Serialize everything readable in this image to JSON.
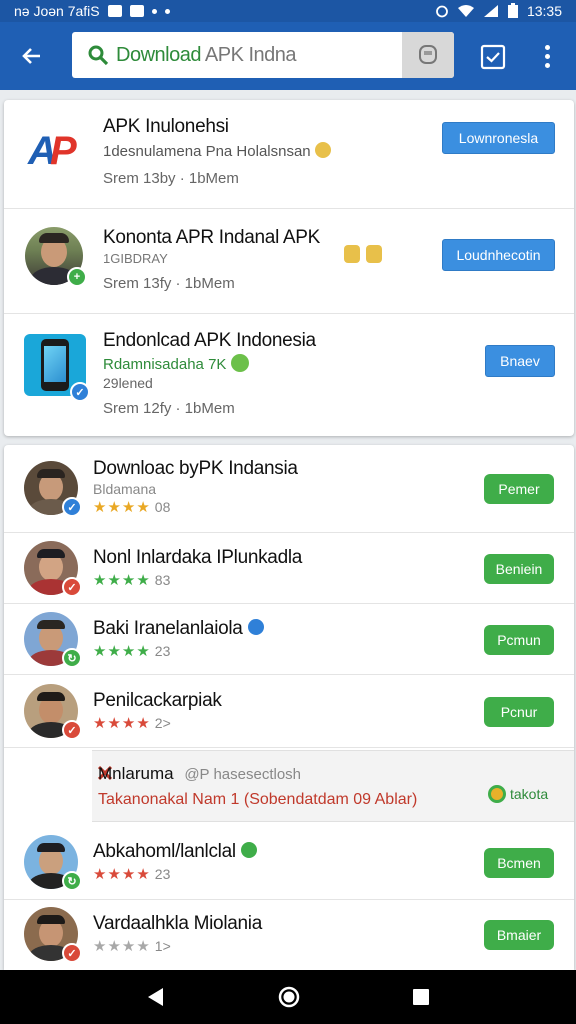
{
  "status_bar": {
    "left_text": "nə Joən 7afiS",
    "time": "13:35"
  },
  "search": {
    "highlight": "Download",
    "rest": " APK Indna"
  },
  "top_results": [
    {
      "title": "APK Inulonehsi",
      "subtitle": "1desnulamena Pna Holalsnsan",
      "meta": "Srem 13by · 1bMem",
      "button": "Lownronesla"
    },
    {
      "title": "Kononta APR Indanal APK",
      "subtitle": "1GIBDRAY",
      "meta": "Srem 13fy · 1bMem",
      "button": "Loudnhecotin"
    },
    {
      "title": "Endonlcad APK Indonesia",
      "subtitle": "Rdamnisadaha 7K",
      "subtitle2": "29lened",
      "meta": "Srem 12fy · 1bMem",
      "button": "Bnaev"
    }
  ],
  "apps": [
    {
      "title": "Downloac byPK Indansia",
      "subtitle": "Bldamana",
      "rating_num": "08",
      "button": "Pemer",
      "star_color": "#e9a825",
      "badge_color": "#2f80d8",
      "badge_icon": "✓"
    },
    {
      "title": "Nonl Inlardaka IPlunkadla",
      "rating_num": "83",
      "button": "Beniein",
      "star_color": "#3fad49",
      "badge_color": "#d94a3a",
      "badge_icon": "✓"
    },
    {
      "title": "Baki Iranelanlaiola",
      "rating_num": "23",
      "button": "Pcmun",
      "star_color": "#3fad49",
      "badge_color": "#3fad49",
      "badge_icon": "↻"
    },
    {
      "title": "Penilcackarpiak",
      "rating_num": "2>",
      "button": "Pcnur",
      "star_color": "#d94a3a",
      "badge_color": "#d94a3a",
      "badge_icon": "✓"
    },
    {
      "title": "Abkahoml/lanlclal",
      "rating_num": "23",
      "button": "Bcmen",
      "star_color": "#d94a3a",
      "badge_color": "#3fad49",
      "badge_icon": "↻"
    },
    {
      "title": "Vardaalhkla Miolania",
      "rating_num": "1>",
      "button": "Bmaier",
      "star_color": "#a8a8a8",
      "badge_color": "#d94a3a",
      "badge_icon": "✓"
    }
  ],
  "promo": {
    "brand": "Mnlaruma",
    "tag": "@P hasesectlosh",
    "text": "Takanonakal Nam 1 (Sobendatdam 09 Ablar)",
    "action": "takota"
  }
}
